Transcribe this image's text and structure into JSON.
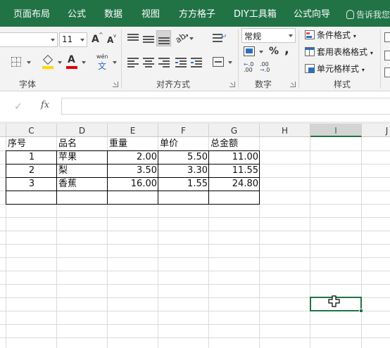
{
  "tabs": [
    "页面布局",
    "公式",
    "数据",
    "视图",
    "方方格子",
    "DIY工具箱",
    "公式向导"
  ],
  "tell_me": "告诉我您",
  "ribbon": {
    "font_group_label": "字体",
    "align_group_label": "对齐方式",
    "number_group_label": "数字",
    "styles_group_label": "样式",
    "font_size": "11",
    "number_format": "常规",
    "increase_font_glyph": "A",
    "decrease_font_glyph": "A",
    "font_color_glyph": "A",
    "phonetic_glyph": "wén",
    "phonetic_sub": "文",
    "percent_glyph": "%",
    "comma_glyph": ",",
    "inc_decimal": "←.0\n.00",
    "conditional_format": "条件格式",
    "format_as_table": "套用表格格式",
    "cell_styles": "单元格样式",
    "fill_color": "#ffd700",
    "font_color": "#e00000"
  },
  "formula_bar": {
    "cancel_glyph": "✕",
    "enter_glyph": "✓",
    "fx_label": "fx",
    "value": ""
  },
  "sheet": {
    "columns": [
      "C",
      "D",
      "E",
      "F",
      "G",
      "H",
      "I",
      "J"
    ],
    "selected_column": "I",
    "rows": [
      [
        "序号",
        "品名",
        "重量",
        "单价",
        "总金额"
      ],
      [
        "1",
        "苹果",
        "2.00",
        "5.50",
        "11.00"
      ],
      [
        "2",
        "梨",
        "3.50",
        "3.30",
        "11.55"
      ],
      [
        "3",
        "香蕉",
        "16.00",
        "1.55",
        "24.80"
      ]
    ]
  },
  "colors": {
    "ribbon_green": "#217346",
    "header_bg": "#f0f0f0",
    "selected_header_bg": "#d4d4d4"
  }
}
